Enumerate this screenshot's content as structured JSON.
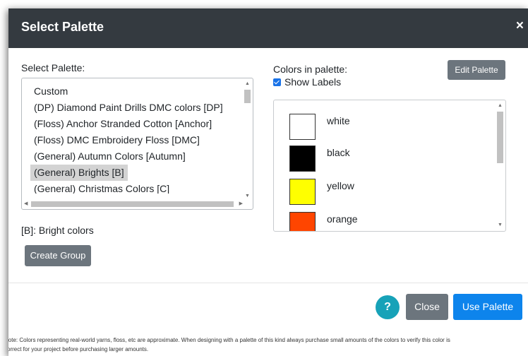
{
  "dialog": {
    "title": "Select Palette",
    "close_glyph": "×"
  },
  "palette_select": {
    "label": "Select Palette:",
    "options": [
      "Custom",
      "(DP) Diamond Paint Drills DMC colors [DP]",
      "(Floss) Anchor Stranded Cotton [Anchor]",
      "(Floss) DMC Embroidery Floss [DMC]",
      "(General) Autumn Colors [Autumn]",
      "(General) Brights [B]",
      "(General) Christmas Colors [C]"
    ],
    "selected_index": 5,
    "description": "[B]: Bright colors"
  },
  "buttons": {
    "create_group": "Create Group",
    "edit_palette": "Edit Palette",
    "help": "?",
    "close": "Close",
    "use_palette": "Use Palette"
  },
  "colors_panel": {
    "label": "Colors in palette:",
    "show_labels": "Show Labels",
    "show_labels_checked": true,
    "colors": [
      {
        "name": "white",
        "hex": "#ffffff"
      },
      {
        "name": "black",
        "hex": "#000000"
      },
      {
        "name": "yellow",
        "hex": "#ffff00"
      },
      {
        "name": "orange",
        "hex": "#ff4500"
      }
    ]
  },
  "note": {
    "line1": "Note: Colors representing real-world yarns, floss, etc are approximate. When designing with a palette of this kind always purchase small amounts of the colors to verify this color is",
    "line2": "correct for your project before purchasing larger amounts."
  },
  "theme": {
    "header_bg": "#343a40",
    "primary": "#0d84ec",
    "secondary": "#6c757d",
    "info": "#17a2b8"
  }
}
